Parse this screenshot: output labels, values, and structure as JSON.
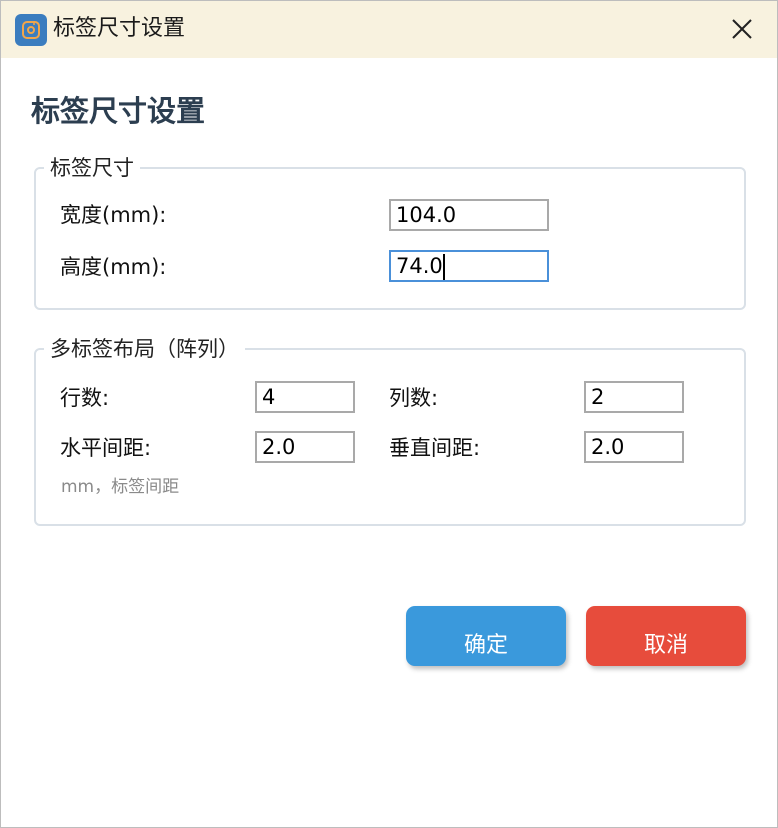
{
  "window": {
    "title": "标签尺寸设置",
    "icon": "camera-app-icon",
    "close_icon": "close-icon"
  },
  "heading": "标签尺寸设置",
  "label_size": {
    "legend": "标签尺寸",
    "width_label": "宽度(mm):",
    "width_value": "104.0",
    "height_label": "高度(mm):",
    "height_value": "74.0"
  },
  "layout": {
    "legend": "多标签布局（阵列）",
    "rows_label": "行数:",
    "rows_value": "4",
    "cols_label": "列数:",
    "cols_value": "2",
    "h_spacing_label": "水平间距:",
    "h_spacing_value": "2.0",
    "v_spacing_label": "垂直间距:",
    "v_spacing_value": "2.0",
    "hint": "mm，标签间距"
  },
  "buttons": {
    "ok_label": "确定",
    "cancel_label": "取消"
  },
  "colors": {
    "titlebar": "#f8f2df",
    "heading": "#2c3e50",
    "ok": "#3a99dc",
    "cancel": "#e74c3c",
    "focus_border": "#4a90d9"
  }
}
